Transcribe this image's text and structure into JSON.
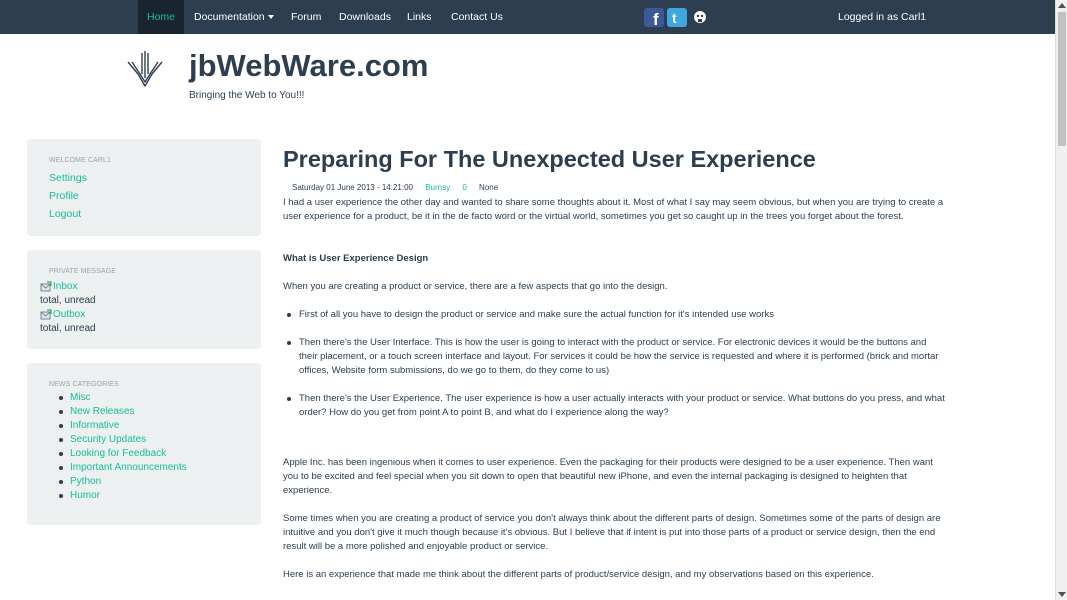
{
  "navbar": {
    "items": [
      "Home",
      "Documentation",
      "Forum",
      "Downloads",
      "Links",
      "Contact Us"
    ],
    "active_index": 0,
    "logged_in": "Logged in as Carl1",
    "social_icons": [
      "facebook-icon",
      "twitter-icon",
      "github-icon"
    ]
  },
  "header": {
    "title": "jbWebWare.com",
    "tagline": "Bringing the Web to You!!!"
  },
  "sidebar": {
    "welcome": {
      "heading": "WELCOME CARL1",
      "links": [
        "Settings",
        "Profile",
        "Logout"
      ]
    },
    "private_message": {
      "heading": "PRIVATE MESSAGE",
      "inbox_label": "Inbox",
      "inbox_status": "total, unread",
      "outbox_label": "Outbox",
      "outbox_status": "total, unread"
    },
    "news_categories": {
      "heading": "NEWS CATEGORIES",
      "items": [
        "Misc",
        "New Releases",
        "Informative",
        "Security Updates",
        "Looking for Feedback",
        "Important Announcements",
        "Python",
        "Humor"
      ]
    }
  },
  "article": {
    "title": "Preparing For The Unexpected User Experience",
    "date": "Saturday 01 June 2013 - 14:21:00",
    "author": "Burnsy",
    "comments": "0",
    "tags": "None",
    "intro": "I had a user experience the other day and wanted to share some thoughts about it. Most of what I say may seem obvious, but when you are trying to create a user experience for a product, be it in the de facto word or the virtual world, sometimes you get so caught up in the trees you forget about the forest.",
    "subheading": "What is User Experience Design",
    "lead": "When you are creating a product or service, there are a few aspects that go into the design.",
    "bullets": [
      "First of all you have to design the product or service and make sure the actual function for it's intended use works",
      "Then there's the User Interface. This is how the user is going to interact with the product or service. For electronic devices it would be the buttons and their placement, or a touch screen interface and layout. For services it could be how the service is requested and where it is performed (brick and mortar offices, Website form submissions, do we go to them, do they come to us)",
      "Then there's the User Experience. The user experience is how a user actually interacts with your product or service. What buttons do you press, and what order? How do you get from point A to point B, and what do I experience along the way?"
    ],
    "paragraph_apple": "Apple Inc. has been ingenious when it comes to user experience. Even the packaging for their products were designed to be a user experience. Then want you to be excited and feel special when you sit down to open that beautiful new iPhone, and even the internal packaging is designed to heighten that experience.",
    "paragraph_parts": "Some times when you are creating a product of service you don't always think about the different parts of design. Sometimes some of the parts of design are intuitive and you don't give it much though because it's obvious. But I believe that if intent is put into those parts of a product or service design, then the end result will be a more polished and enjoyable product or service.",
    "paragraph_experience": "Here is an experience that made me think about the different parts of product/service design, and my observations based on this experience."
  },
  "colors": {
    "navbar": "#2c3e50",
    "accent": "#18bc9c",
    "well": "#ecf0f1",
    "text": "#2c3e50"
  }
}
